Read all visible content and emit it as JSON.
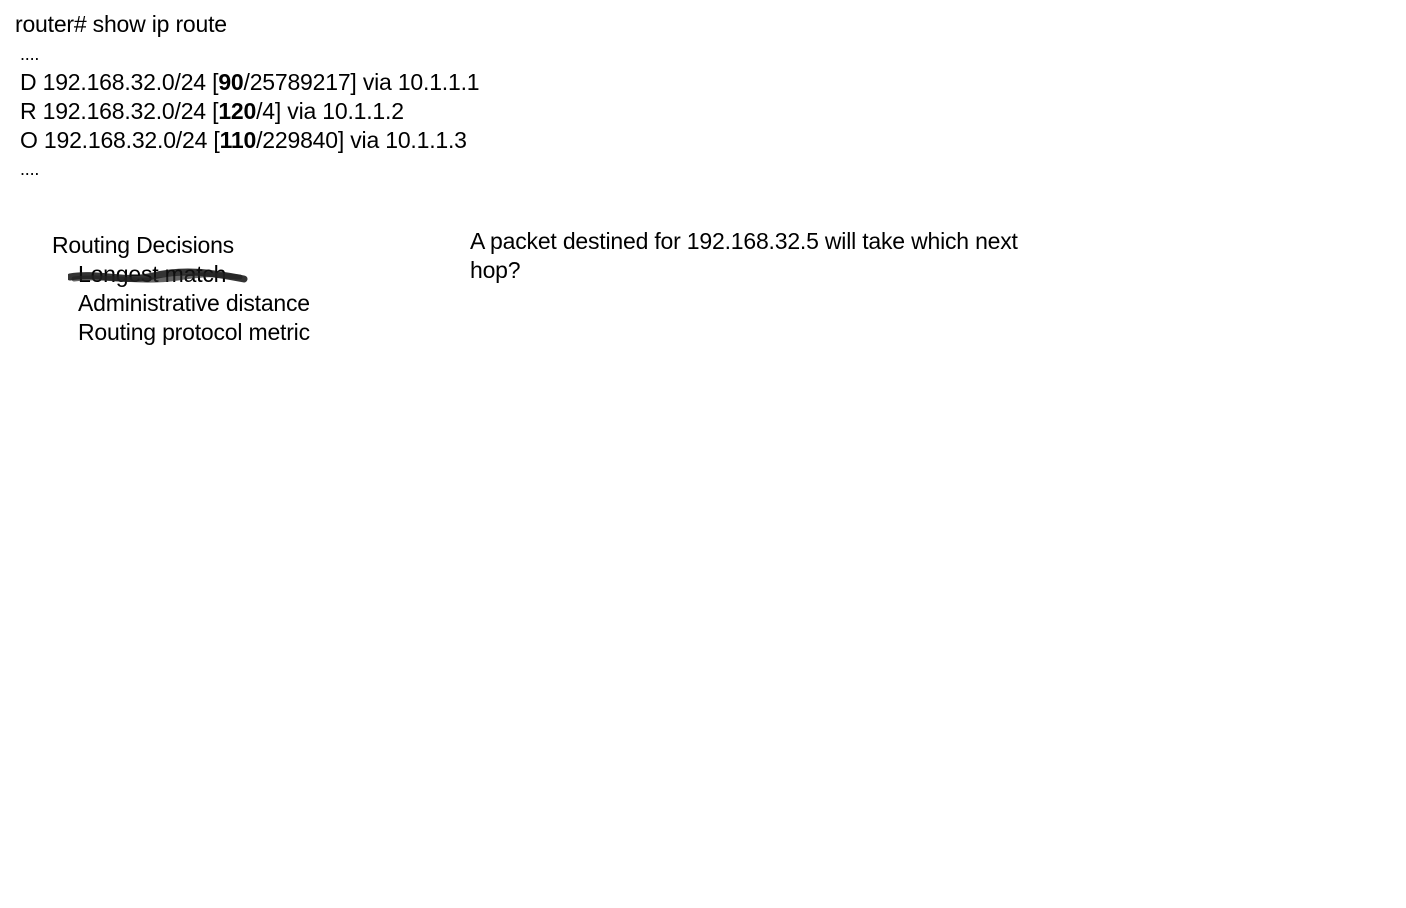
{
  "command": "router# show ip route",
  "ellipsis_top": "....",
  "routes": [
    {
      "code": "D",
      "network": "192.168.32.0/24",
      "open_bracket": "[",
      "admin_distance": "90",
      "metric": "/25789217]",
      "via": "via 10.1.1.1"
    },
    {
      "code": "R",
      "network": "192.168.32.0/24",
      "open_bracket": "[",
      "admin_distance": "120",
      "metric": "/4]",
      "via": "via 10.1.1.2"
    },
    {
      "code": "O",
      "network": "192.168.32.0/24",
      "open_bracket": "[",
      "admin_distance": "110",
      "metric": "/229840]",
      "via": "via 10.1.1.3"
    }
  ],
  "ellipsis_bottom": "....",
  "decisions": {
    "title": "Routing Decisions",
    "items": [
      {
        "label": "Longest match",
        "crossed_out": true
      },
      {
        "label": "Administrative distance",
        "crossed_out": false
      },
      {
        "label": "Routing protocol metric",
        "crossed_out": false
      }
    ]
  },
  "question": "A packet destined for 192.168.32.5 will take which next hop?"
}
